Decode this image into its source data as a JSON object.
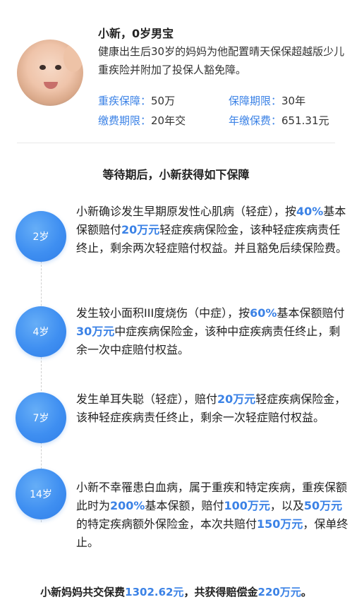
{
  "profile": {
    "name": "小新，0岁男宝",
    "desc": "健康出生后30岁的妈妈为他配置晴天保保超越版少儿重疾险并附加了投保人豁免障。",
    "info": [
      {
        "key": "重疾保障：",
        "value": "50万"
      },
      {
        "key": "保障期限：",
        "value": "30年"
      },
      {
        "key": "缴费期限：",
        "value": "20年交"
      },
      {
        "key": "年缴保费：",
        "value": "651.31元"
      }
    ]
  },
  "section_title": "等待期后，小新获得如下保障",
  "timeline": [
    {
      "age": "2岁",
      "parts": [
        "小新确诊发生早期原发性心肌病（轻症），按",
        "40%",
        "基本保额赔付",
        "20万元",
        "轻症疾病保险金，该种轻症疾病责任终止，剩余两次轻症赔付权益。并且豁免后续保险费。"
      ]
    },
    {
      "age": "4岁",
      "parts": [
        "发生较小面积III度烧伤（中症），按",
        "60%",
        "基本保额赔付",
        "30万元",
        "中症疾病保险金，该种中症疾病责任终止，剩余一次中症赔付权益。"
      ]
    },
    {
      "age": "7岁",
      "parts": [
        "发生单耳失聪（轻症），赔付",
        "20万元",
        "轻症疾病保险金，该种轻症疾病责任终止，剩余一次轻症赔付权益。"
      ]
    },
    {
      "age": "14岁",
      "parts": [
        "小新不幸罹患白血病，属于重疾和特定疾病，重疾保额此时为",
        "200%",
        "基本保额，赔付",
        "100万元",
        "，以及",
        "50万元",
        "的特定疾病额外保险金，本次共赔付",
        "150万元",
        "，保单终止。"
      ]
    }
  ],
  "summary": {
    "parts": [
      "小新妈妈共交保费",
      "1302.62元",
      "，共获得赔偿金",
      "220万元",
      "。"
    ]
  },
  "colors": {
    "accent": "#3b82e6",
    "circle": "#3f8ff1"
  }
}
